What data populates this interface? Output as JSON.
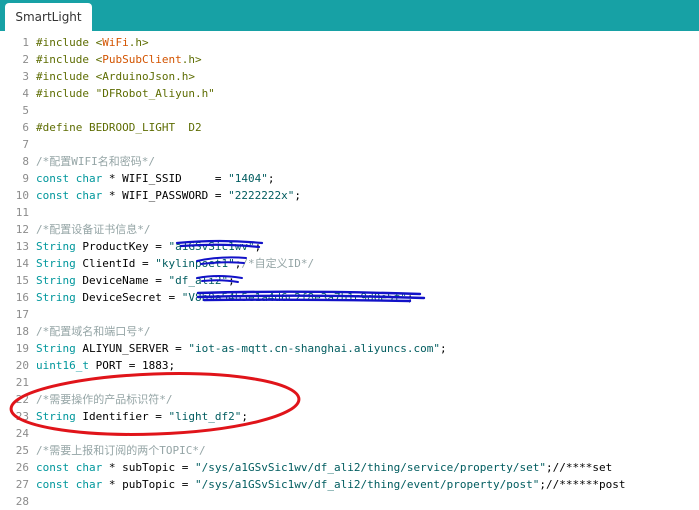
{
  "tab": {
    "label": "SmartLight"
  },
  "lines": [
    {
      "n": "1",
      "parts": [
        {
          "t": "#include <",
          "c": "pp"
        },
        {
          "t": "WiFi",
          "c": "lib"
        },
        {
          "t": ".h>",
          "c": "pp"
        }
      ]
    },
    {
      "n": "2",
      "parts": [
        {
          "t": "#include <",
          "c": "pp"
        },
        {
          "t": "PubSubClient",
          "c": "lib"
        },
        {
          "t": ".h>",
          "c": "pp"
        }
      ]
    },
    {
      "n": "3",
      "parts": [
        {
          "t": "#include <ArduinoJson.h>",
          "c": "pp"
        }
      ]
    },
    {
      "n": "4",
      "parts": [
        {
          "t": "#include \"DFRobot_Aliyun.h\"",
          "c": "pp"
        }
      ]
    },
    {
      "n": "5",
      "parts": []
    },
    {
      "n": "6",
      "parts": [
        {
          "t": "#define BEDROOD_LIGHT  D2",
          "c": "pp"
        }
      ]
    },
    {
      "n": "7",
      "parts": []
    },
    {
      "n": "8",
      "parts": [
        {
          "t": "/*配置WIFI名和密码*/",
          "c": "cm"
        }
      ]
    },
    {
      "n": "9",
      "parts": [
        {
          "t": "const ",
          "c": "kw"
        },
        {
          "t": "char",
          "c": "kw"
        },
        {
          "t": " * WIFI_SSID     = ",
          "c": ""
        },
        {
          "t": "\"1404\"",
          "c": "str"
        },
        {
          "t": ";",
          "c": ""
        }
      ]
    },
    {
      "n": "10",
      "parts": [
        {
          "t": "const ",
          "c": "kw"
        },
        {
          "t": "char",
          "c": "kw"
        },
        {
          "t": " * WIFI_PASSWORD = ",
          "c": ""
        },
        {
          "t": "\"2222222x\"",
          "c": "str"
        },
        {
          "t": ";",
          "c": ""
        }
      ]
    },
    {
      "n": "11",
      "parts": []
    },
    {
      "n": "12",
      "parts": [
        {
          "t": "/*配置设备证书信息*/",
          "c": "cm"
        }
      ]
    },
    {
      "n": "13",
      "parts": [
        {
          "t": "String",
          "c": "kw"
        },
        {
          "t": " ProductKey = ",
          "c": ""
        },
        {
          "t": "\"a1GSvSic1wv\"",
          "c": "str"
        },
        {
          "t": ";",
          "c": ""
        }
      ]
    },
    {
      "n": "14",
      "parts": [
        {
          "t": "String",
          "c": "kw"
        },
        {
          "t": " ClientId = ",
          "c": ""
        },
        {
          "t": "\"kylinpoet1\"",
          "c": "str"
        },
        {
          "t": ";",
          "c": ""
        },
        {
          "t": "/*自定义ID*/",
          "c": "cm"
        }
      ]
    },
    {
      "n": "15",
      "parts": [
        {
          "t": "String",
          "c": "kw"
        },
        {
          "t": " DeviceName = ",
          "c": ""
        },
        {
          "t": "\"df_ali2\"",
          "c": "str"
        },
        {
          "t": ";",
          "c": ""
        }
      ]
    },
    {
      "n": "16",
      "parts": [
        {
          "t": "String",
          "c": "kw"
        },
        {
          "t": " DeviceSecret = ",
          "c": ""
        },
        {
          "t": "\"V8b9a54b5e1a4d6c2f8e3a7b1c9d0e5f\"",
          "c": "str"
        },
        {
          "t": ";",
          "c": ""
        }
      ]
    },
    {
      "n": "17",
      "parts": []
    },
    {
      "n": "18",
      "parts": [
        {
          "t": "/*配置域名和端口号*/",
          "c": "cm"
        }
      ]
    },
    {
      "n": "19",
      "parts": [
        {
          "t": "String",
          "c": "kw"
        },
        {
          "t": " ALIYUN_SERVER = ",
          "c": ""
        },
        {
          "t": "\"iot-as-mqtt.cn-shanghai.aliyuncs.com\"",
          "c": "str"
        },
        {
          "t": ";",
          "c": ""
        }
      ]
    },
    {
      "n": "20",
      "parts": [
        {
          "t": "uint16_t",
          "c": "kw"
        },
        {
          "t": " PORT = 1883;",
          "c": ""
        }
      ]
    },
    {
      "n": "21",
      "parts": []
    },
    {
      "n": "22",
      "parts": [
        {
          "t": "/*需要操作的产品标识符*/",
          "c": "cm"
        }
      ]
    },
    {
      "n": "23",
      "parts": [
        {
          "t": "String",
          "c": "kw"
        },
        {
          "t": " Identifier = ",
          "c": ""
        },
        {
          "t": "\"light_df2\"",
          "c": "str"
        },
        {
          "t": ";",
          "c": ""
        }
      ]
    },
    {
      "n": "24",
      "parts": []
    },
    {
      "n": "25",
      "parts": [
        {
          "t": "/*需要上报和订阅的两个TOPIC*/",
          "c": "cm"
        }
      ]
    },
    {
      "n": "26",
      "parts": [
        {
          "t": "const ",
          "c": "kw"
        },
        {
          "t": "char",
          "c": "kw"
        },
        {
          "t": " * subTopic = ",
          "c": ""
        },
        {
          "t": "\"/sys/a1GSvSic1wv/df_ali2/thing/service/property/set\"",
          "c": "str"
        },
        {
          "t": ";//****set",
          "c": ""
        }
      ]
    },
    {
      "n": "27",
      "parts": [
        {
          "t": "const ",
          "c": "kw"
        },
        {
          "t": "char",
          "c": "kw"
        },
        {
          "t": " * pubTopic = ",
          "c": ""
        },
        {
          "t": "\"/sys/a1GSvSic1wv/df_ali2/thing/event/property/post\"",
          "c": "str"
        },
        {
          "t": ";//******post",
          "c": ""
        }
      ]
    },
    {
      "n": "28",
      "parts": []
    }
  ],
  "colors": {
    "tabbar": "#17a1a5",
    "scribble": "#1212c8",
    "highlight_ellipse": "#e0141a"
  }
}
